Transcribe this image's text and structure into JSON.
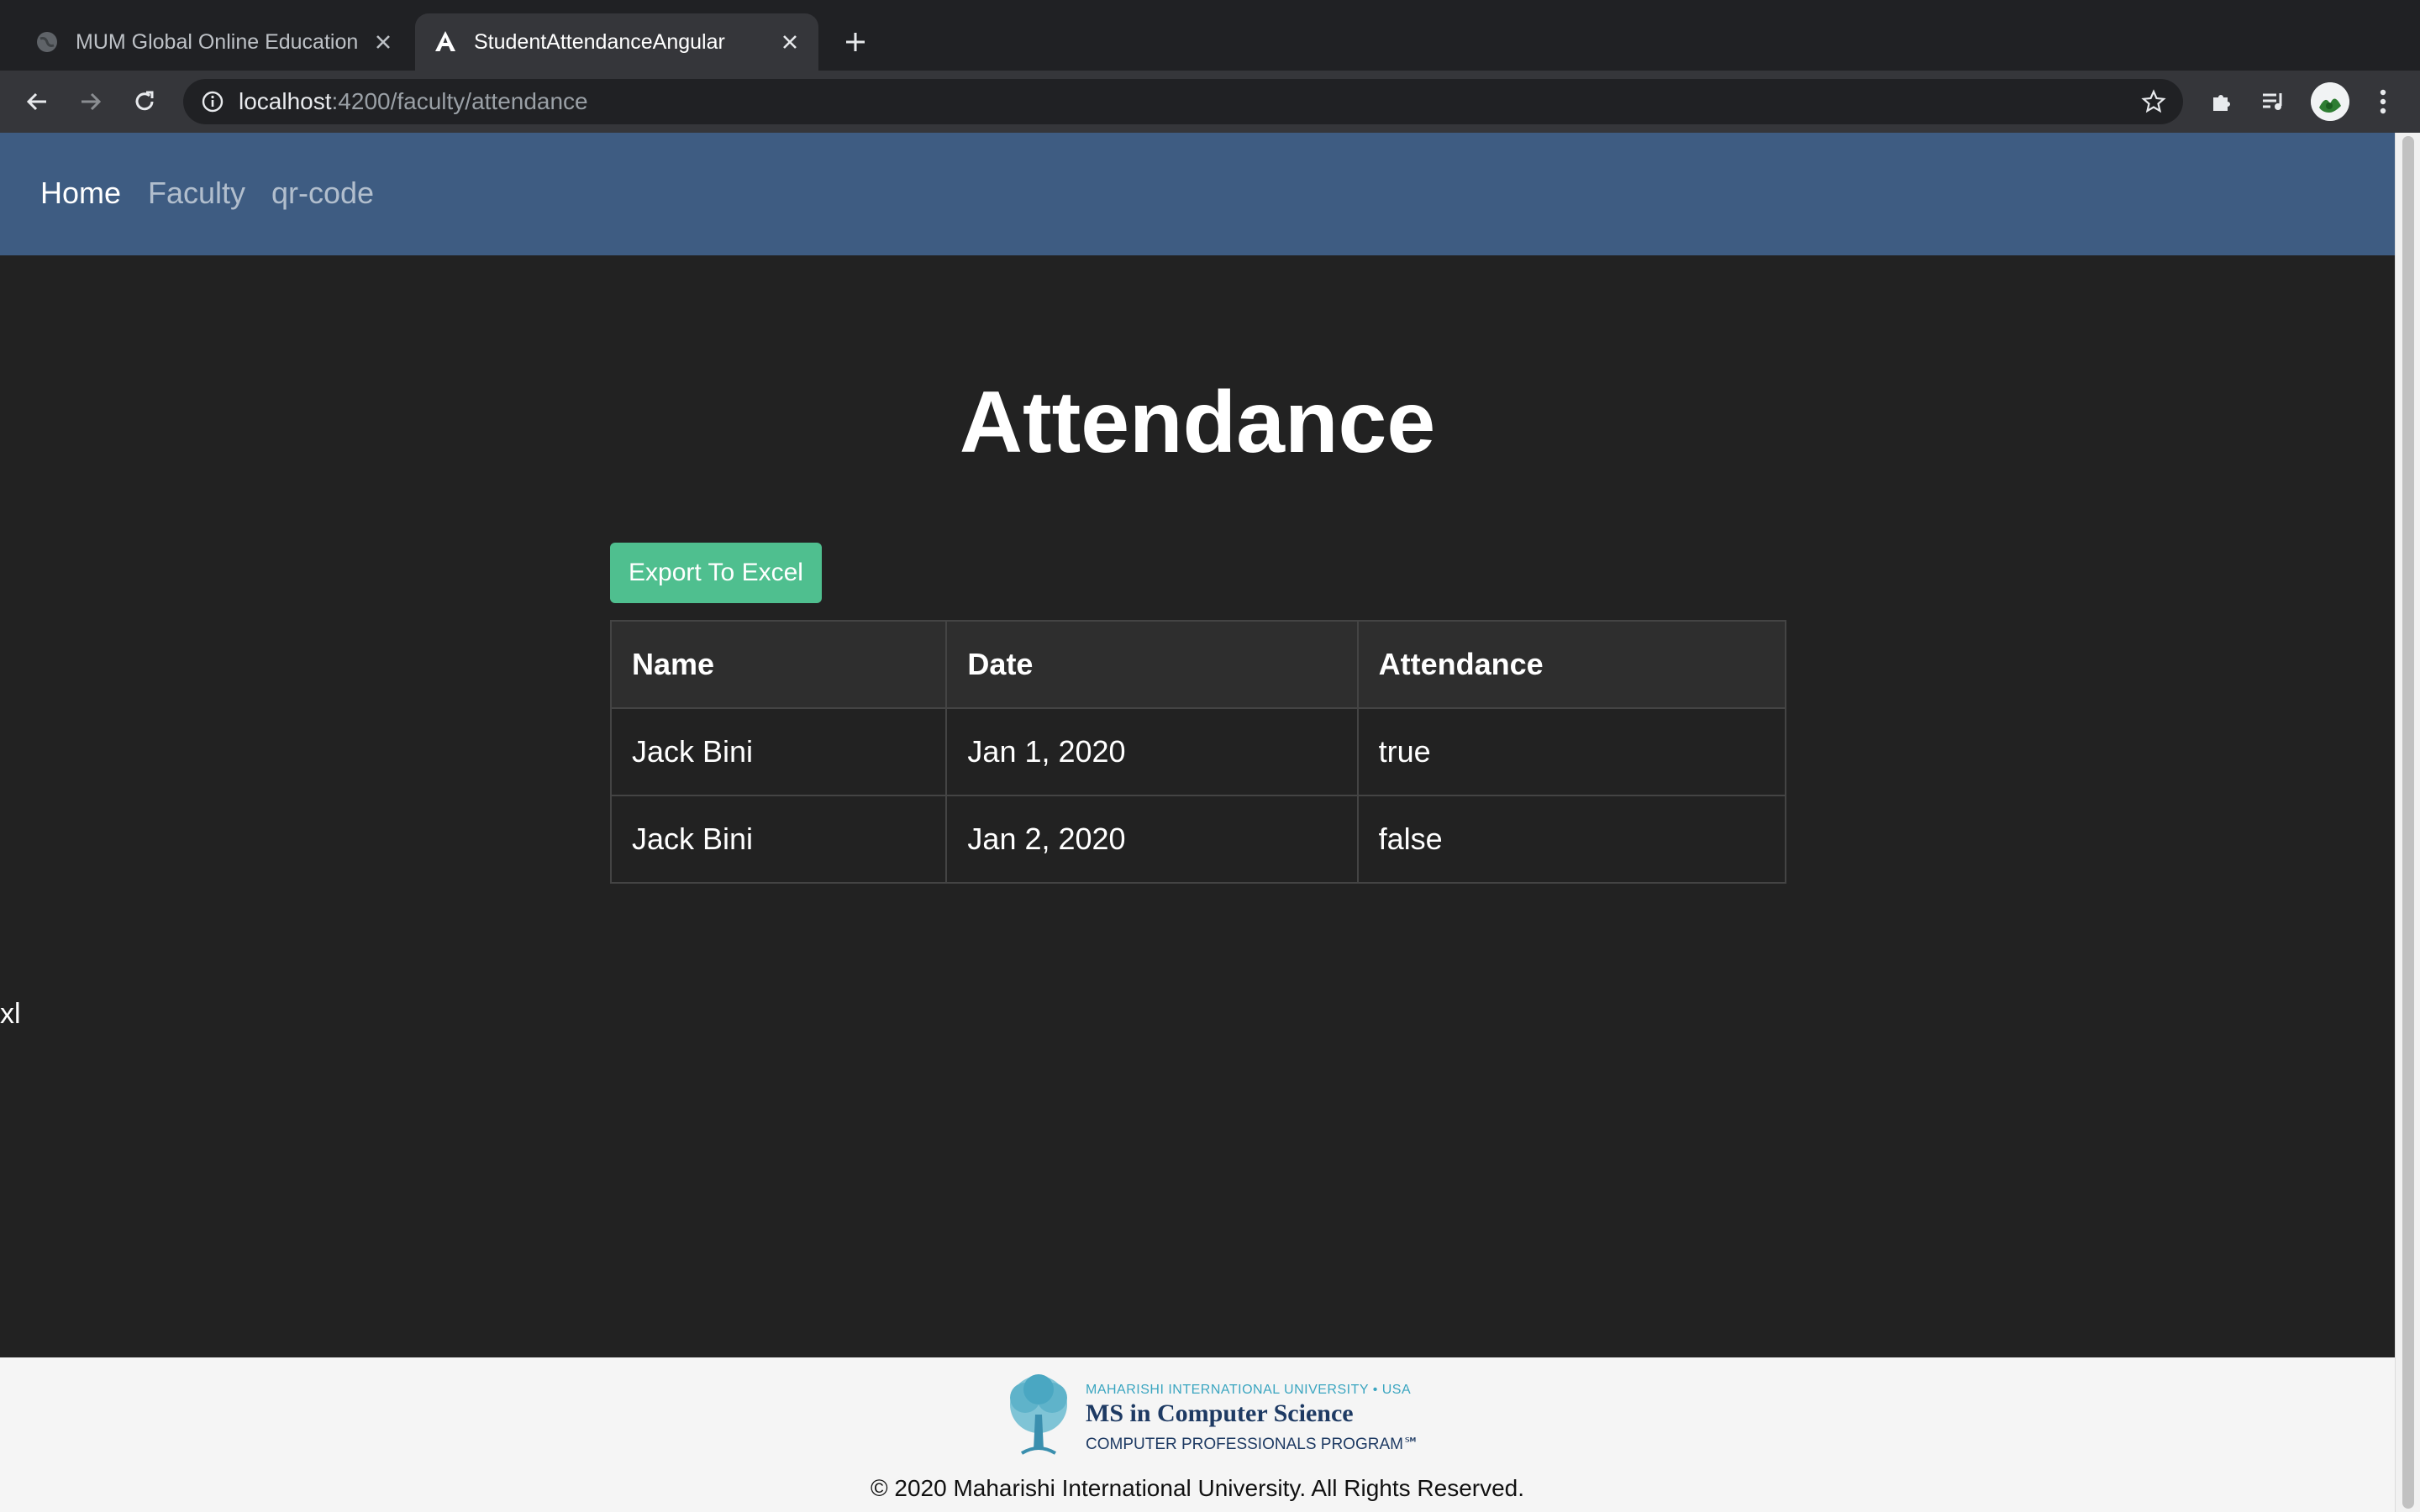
{
  "browser": {
    "tabs": [
      {
        "title": "MUM Global Online Education",
        "active": false,
        "icon": "globe-icon"
      },
      {
        "title": "StudentAttendanceAngular",
        "active": true,
        "icon": "angular-icon"
      }
    ],
    "address": {
      "host": "localhost",
      "rest": ":4200/faculty/attendance"
    }
  },
  "nav": {
    "items": [
      {
        "label": "Home",
        "active": true
      },
      {
        "label": "Faculty",
        "active": false
      },
      {
        "label": "qr-code",
        "active": false
      }
    ]
  },
  "page": {
    "title": "Attendance",
    "export_label": "Export To Excel",
    "stray_text": "xl"
  },
  "table": {
    "headers": [
      "Name",
      "Date",
      "Attendance"
    ],
    "rows": [
      [
        "Jack Bini",
        "Jan 1, 2020",
        "true"
      ],
      [
        "Jack Bini",
        "Jan 2, 2020",
        "false"
      ]
    ]
  },
  "footer": {
    "logo_small": "MAHARISHI INTERNATIONAL UNIVERSITY • USA",
    "logo_main": "MS in Computer Science",
    "logo_sub": "COMPUTER PROFESSIONALS PROGRAM℠",
    "copyright": "© 2020 Maharishi International University. All Rights Reserved."
  },
  "colors": {
    "navbar": "#3e5c82",
    "background": "#222222",
    "export_button": "#4fbf8f",
    "footer": "#f5f5f5"
  }
}
